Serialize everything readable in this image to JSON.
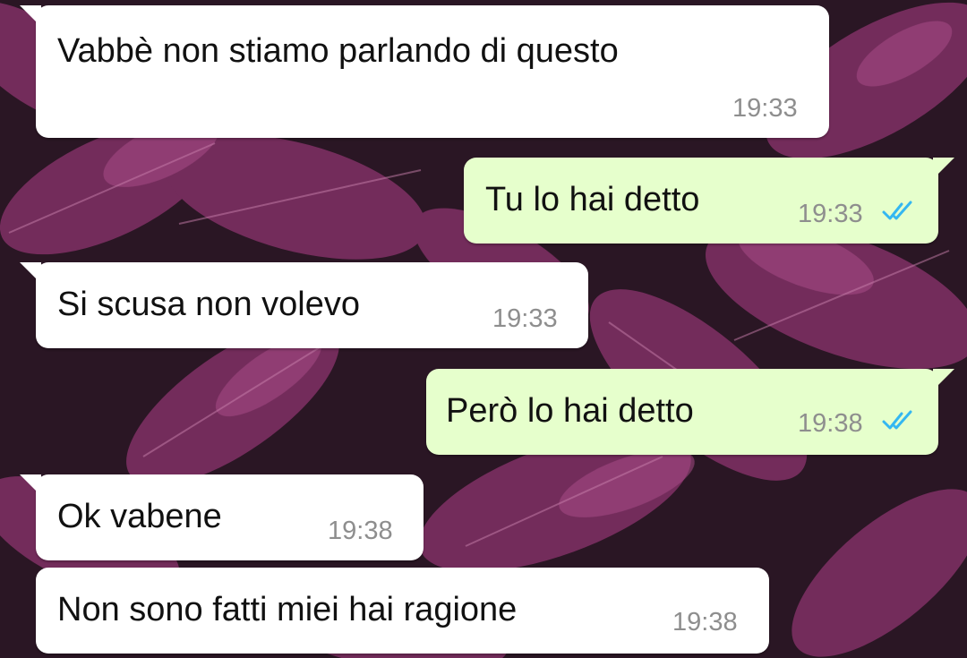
{
  "colors": {
    "incoming_bubble": "#ffffff",
    "outgoing_bubble": "#e6ffcc",
    "message_text": "#111111",
    "timestamp": "#8e8e8e",
    "read_ticks": "#34b7f1",
    "wallpaper_dark": "#2a1624",
    "wallpaper_leaf": "#8a3a6e"
  },
  "messages": [
    {
      "direction": "incoming",
      "text": "Vabbè non stiamo parlando di questo",
      "time": "19:33"
    },
    {
      "direction": "outgoing",
      "text": "Tu lo hai detto",
      "time": "19:33",
      "status_icon": "double-check-read-icon"
    },
    {
      "direction": "incoming",
      "text": "Si scusa non volevo",
      "time": "19:33"
    },
    {
      "direction": "outgoing",
      "text": "Però lo hai detto",
      "time": "19:38",
      "status_icon": "double-check-read-icon"
    },
    {
      "direction": "incoming",
      "text": "Ok vabene",
      "time": "19:38"
    },
    {
      "direction": "incoming",
      "text": "Non sono fatti miei hai ragione",
      "time": "19:38"
    }
  ]
}
